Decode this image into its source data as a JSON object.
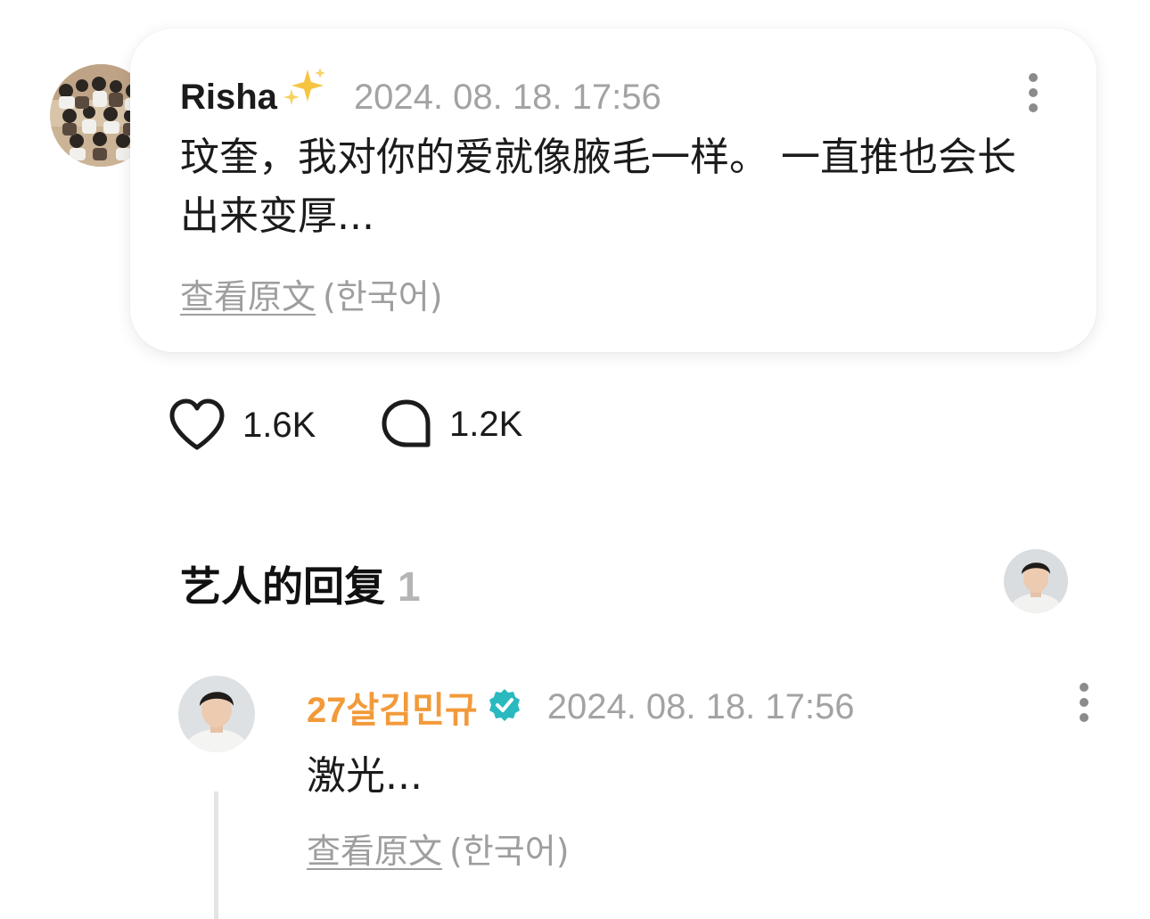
{
  "post": {
    "username": "Risha",
    "emoji": "✨",
    "timestamp": "2024. 08. 18. 17:56",
    "text": "玟奎，我对你的爱就像腋毛一样。 一直推也会长出来变厚...",
    "translate_link": "查看原文",
    "translate_lang": "(한국어)"
  },
  "actions": {
    "likes": "1.6K",
    "comments": "1.2K"
  },
  "artist_replies": {
    "title": "艺人的回复",
    "count": "1"
  },
  "reply": {
    "username": "27살김민규",
    "timestamp": "2024. 08. 18. 17:56",
    "text": "激光...",
    "translate_link": "查看原文",
    "translate_lang": "(한국어)"
  },
  "colors": {
    "reply_username": "#f29a3a",
    "verified_badge": "#2bb9c0",
    "timestamp": "#a3a3a3",
    "section_count": "#b5b5b5"
  }
}
